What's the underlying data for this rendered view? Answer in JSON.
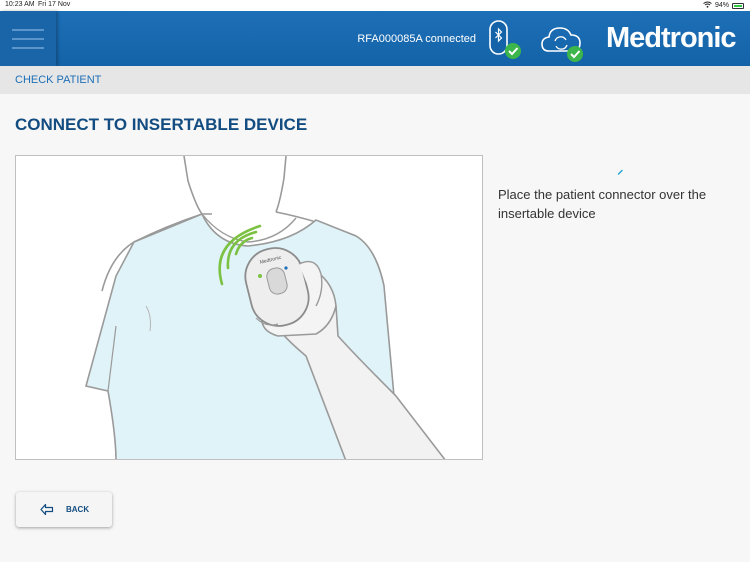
{
  "status_bar": {
    "time": "10:23 AM",
    "date": "Fri 17 Nov",
    "battery": "94%"
  },
  "header": {
    "connection_text": "RFA000085A connected",
    "logo": "Medtronic",
    "icons": [
      "bluetooth-reader-connected-icon",
      "cloud-sync-connected-icon",
      "menu-icon"
    ]
  },
  "breadcrumb": {
    "label": "CHECK PATIENT"
  },
  "main": {
    "title": "CONNECT TO INSERTABLE DEVICE",
    "instruction": "Place the patient connector over the insertable device",
    "illustration_device_label": "Medtronic"
  },
  "footer": {
    "back_label": "BACK"
  },
  "colors": {
    "header_blue": "#1d6fb7",
    "title_blue": "#134c80",
    "success_green": "#3cb54a",
    "signal_green": "#7cc242",
    "gown_blue": "#e0f3f8"
  }
}
